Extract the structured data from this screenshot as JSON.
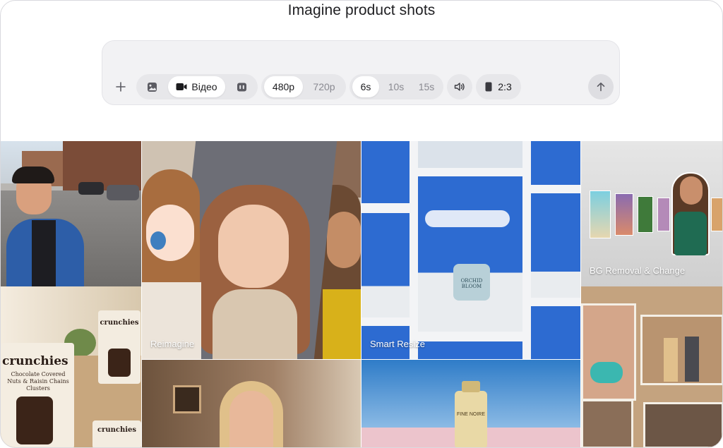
{
  "header": {
    "title": "Imagine product shots"
  },
  "composer": {
    "add_icon": "plus-icon",
    "modes": [
      {
        "name": "image",
        "icon": "image-icon",
        "label": ""
      },
      {
        "name": "video",
        "icon": "video-camera-icon",
        "label": "Відео",
        "active": true
      },
      {
        "name": "storyboard",
        "icon": "storyboard-icon",
        "label": ""
      }
    ],
    "resolutions": [
      {
        "label": "480p",
        "active": true
      },
      {
        "label": "720p",
        "active": false
      }
    ],
    "durations": [
      {
        "label": "6s",
        "active": true
      },
      {
        "label": "10s",
        "active": false
      },
      {
        "label": "15s",
        "active": false
      }
    ],
    "sound_icon": "speaker-icon",
    "aspect": {
      "icon": "portrait-frame-icon",
      "label": "2:3"
    },
    "send_icon": "arrow-up-icon"
  },
  "gallery": {
    "labels": {
      "reimagine": "Reimagine",
      "smart_resize": "Smart Resize",
      "bg_removal": "BG Removal & Change"
    },
    "product_text": {
      "brand": "crunchies",
      "description": "Chocolate Covered Nuts & Raisin Chains Clusters",
      "jar": "ORCHID BLOOM",
      "perfume": "FINE NOIRE"
    }
  },
  "colors": {
    "panel_bg": "#f2f2f4",
    "pill_bg": "#e7e7ea",
    "active_seg": "#ffffff",
    "sky_blue": "#2d6bd1"
  }
}
